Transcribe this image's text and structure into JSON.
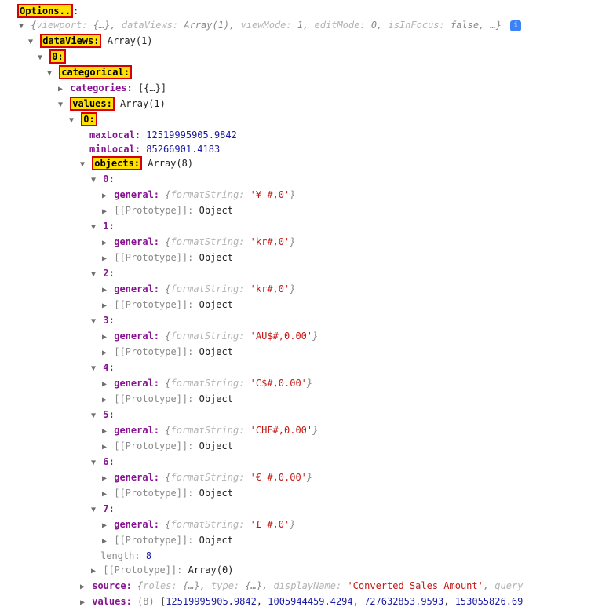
{
  "options_label": "Options..",
  "root_summary": {
    "viewport_key": "viewport:",
    "viewport_val": "{…}",
    "dataViews_key": "dataViews:",
    "dataViews_val": "Array(1)",
    "viewMode_key": "viewMode:",
    "viewMode_val": "1",
    "editMode_key": "editMode:",
    "editMode_val": "0",
    "isInFocus_key": "isInFocus:",
    "isInFocus_val": "false",
    "ellipsis": "…"
  },
  "dataViews": {
    "key": "dataViews:",
    "type": "Array(1)"
  },
  "dv_index": {
    "key": "0:"
  },
  "categorical": {
    "key": "categorical:"
  },
  "categories": {
    "key": "categories:",
    "val": "[{…}]"
  },
  "values": {
    "key": "values:",
    "type": "Array(1)"
  },
  "values_index": {
    "key": "0:"
  },
  "maxLocal": {
    "key": "maxLocal:",
    "val": "12519995905.9842"
  },
  "minLocal": {
    "key": "minLocal:",
    "val": "85266901.4183"
  },
  "objects": {
    "key": "objects:",
    "type": "Array(8)"
  },
  "obj": [
    {
      "idx": "0:",
      "general_key": "general:",
      "fs_key": "formatString:",
      "fs_val": "'¥ #,0'",
      "proto_key": "[[Prototype]]:",
      "proto_val": "Object"
    },
    {
      "idx": "1:",
      "general_key": "general:",
      "fs_key": "formatString:",
      "fs_val": "'kr#,0'",
      "proto_key": "[[Prototype]]:",
      "proto_val": "Object"
    },
    {
      "idx": "2:",
      "general_key": "general:",
      "fs_key": "formatString:",
      "fs_val": "'kr#,0'",
      "proto_key": "[[Prototype]]:",
      "proto_val": "Object"
    },
    {
      "idx": "3:",
      "general_key": "general:",
      "fs_key": "formatString:",
      "fs_val": "'AU$#,0.00'",
      "proto_key": "[[Prototype]]:",
      "proto_val": "Object"
    },
    {
      "idx": "4:",
      "general_key": "general:",
      "fs_key": "formatString:",
      "fs_val": "'C$#,0.00'",
      "proto_key": "[[Prototype]]:",
      "proto_val": "Object"
    },
    {
      "idx": "5:",
      "general_key": "general:",
      "fs_key": "formatString:",
      "fs_val": "'CHF#,0.00'",
      "proto_key": "[[Prototype]]:",
      "proto_val": "Object"
    },
    {
      "idx": "6:",
      "general_key": "general:",
      "fs_key": "formatString:",
      "fs_val": "'€ #,0.00'",
      "proto_key": "[[Prototype]]:",
      "proto_val": "Object"
    },
    {
      "idx": "7:",
      "general_key": "general:",
      "fs_key": "formatString:",
      "fs_val": "'£ #,0'",
      "proto_key": "[[Prototype]]:",
      "proto_val": "Object"
    }
  ],
  "objects_length": {
    "key": "length:",
    "val": "8"
  },
  "objects_proto": {
    "key": "[[Prototype]]:",
    "val": "Array(0)"
  },
  "source": {
    "key": "source:",
    "roles_key": "roles:",
    "roles_val": "{…}",
    "type_key": "type:",
    "type_val": "{…}",
    "displayName_key": "displayName:",
    "displayName_val": "'Converted Sales Amount'",
    "query_key": "query"
  },
  "values_arr": {
    "key": "values:",
    "count": "(8)",
    "v0": "12519995905.9842",
    "v1": "1005944459.4294",
    "v2": "727632853.9593",
    "v3": "153055826.69"
  },
  "info_badge": "i",
  "arrow_down": "▼",
  "arrow_right": "▶"
}
